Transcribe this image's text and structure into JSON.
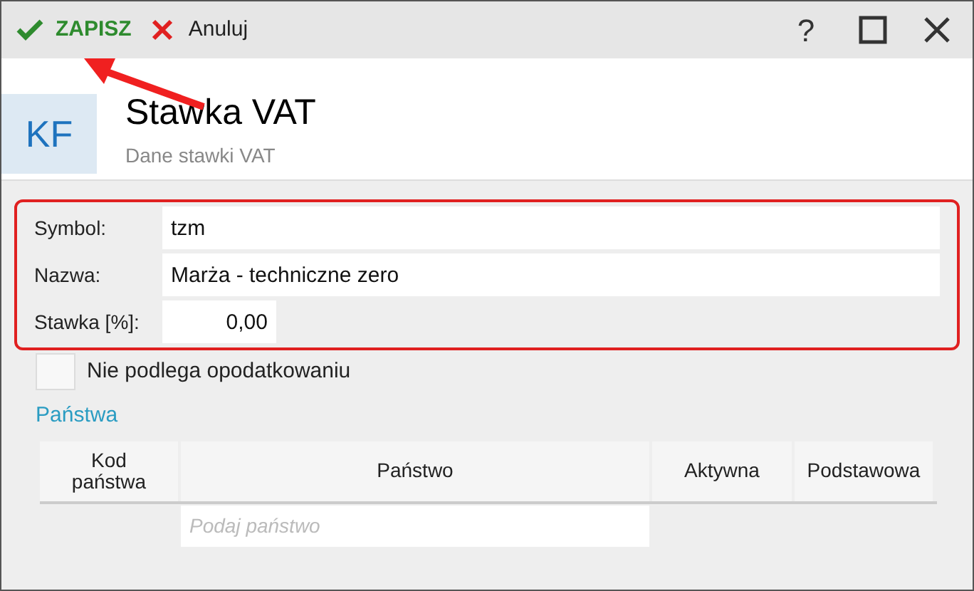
{
  "toolbar": {
    "save": "ZAPISZ",
    "cancel": "Anuluj",
    "help": "?"
  },
  "header": {
    "badge": "KF",
    "title": "Stawka VAT",
    "subtitle": "Dane stawki VAT"
  },
  "form": {
    "fields": [
      {
        "label": "Symbol:",
        "value": "tzm",
        "kind": "wide"
      },
      {
        "label": "Nazwa:",
        "value": "Marża - techniczne zero",
        "kind": "wide"
      },
      {
        "label": "Stawka [%]:",
        "value": "0,00",
        "kind": "number"
      }
    ]
  },
  "exempt": {
    "label": "Nie podlega opodatkowaniu",
    "checked": false
  },
  "countries": {
    "title": "Państwa",
    "columns": [
      "Kod państwa",
      "Państwo",
      "Aktywna",
      "Podstawowa"
    ],
    "new_row": {
      "placeholder": "Podaj państwo"
    }
  }
}
